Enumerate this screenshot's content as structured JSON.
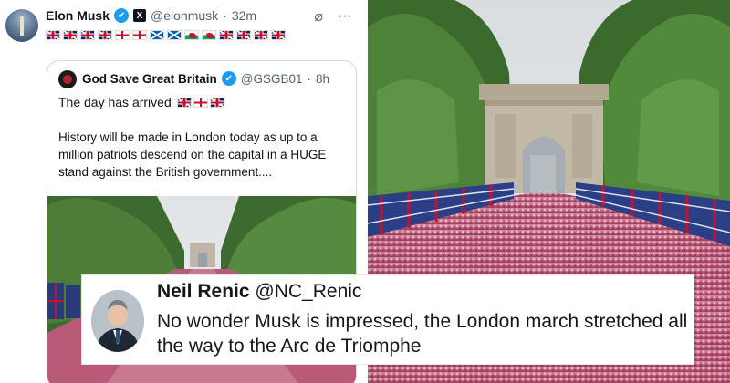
{
  "tweet": {
    "author_name": "Elon Musk",
    "author_handle": "@elonmusk",
    "time": "32m",
    "verified_icon": "✔",
    "x_badge": "X",
    "actions": {
      "grok_icon": "⌀",
      "more_icon": "···"
    },
    "flags": [
      "uk",
      "uk",
      "uk",
      "uk",
      "eng",
      "eng",
      "sco",
      "sco",
      "wal",
      "wal",
      "uk",
      "uk",
      "uk",
      "uk"
    ]
  },
  "quoted": {
    "author_name": "God Save Great Britain",
    "author_handle": "@GSGB01",
    "time": "8h",
    "line1": "The day has arrived",
    "line1_flags": [
      "uk",
      "eng",
      "uk"
    ],
    "body": "History will be made in London today as up to a million patriots descend on the capital in a HUGE stand against the British government...."
  },
  "reply": {
    "name": "Neil Renic",
    "handle": "@NC_Renic",
    "text": "No wonder Musk is impressed, the London march stretched all the way to the Arc de Triomphe"
  },
  "colors": {
    "accent": "#1d9bf0",
    "text": "#0f1419",
    "muted": "#536471"
  }
}
